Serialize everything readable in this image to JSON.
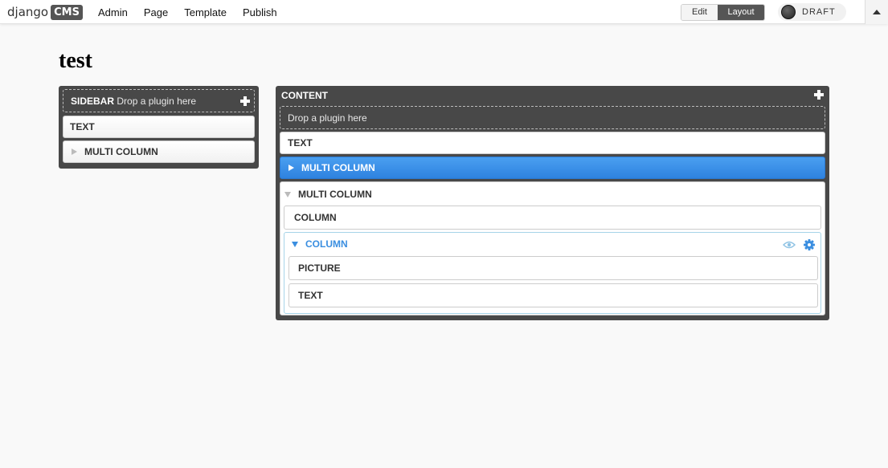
{
  "toolbar": {
    "logo_text": "django",
    "logo_badge": "CMS",
    "menu": [
      "Admin",
      "Page",
      "Template",
      "Publish"
    ],
    "mode_edit": "Edit",
    "mode_layout": "Layout",
    "mode_active": "Layout",
    "draft_label": "DRAFT"
  },
  "page": {
    "title": "test"
  },
  "sidebar": {
    "name": "SIDEBAR",
    "drop_hint": "Drop a plugin here",
    "plugins": [
      {
        "label": "TEXT"
      },
      {
        "label": "MULTI COLUMN",
        "collapsed": true
      }
    ]
  },
  "content": {
    "name": "CONTENT",
    "drop_hint": "Drop a plugin here",
    "plugins": [
      {
        "label": "TEXT"
      },
      {
        "label": "MULTI COLUMN",
        "collapsed": true,
        "highlighted": true
      },
      {
        "label": "MULTI COLUMN",
        "expanded": true,
        "children": [
          {
            "label": "COLUMN"
          },
          {
            "label": "COLUMN",
            "expanded": true,
            "children": [
              {
                "label": "PICTURE"
              },
              {
                "label": "TEXT"
              }
            ]
          }
        ]
      }
    ]
  },
  "colors": {
    "placeholder_bg": "#484848",
    "highlight_blue": "#3a8ee0",
    "column_border": "#a6d4e8",
    "toolbar_bg": "#ffffff",
    "page_bg": "#f9f9f9"
  }
}
